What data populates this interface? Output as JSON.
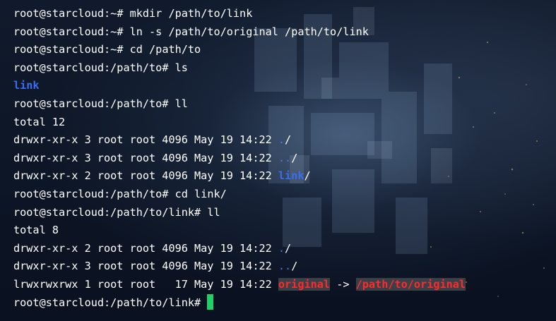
{
  "prompt": "root@starcloud:",
  "session": [
    {
      "cwd": "~",
      "command": "mkdir /path/to/link"
    },
    {
      "cwd": "~",
      "command": "ln -s /path/to/original /path/to/link"
    },
    {
      "cwd": "~",
      "command": "cd /path/to"
    },
    {
      "cwd": "/path/to",
      "command": "ls"
    },
    {
      "cwd": "/path/to",
      "command": "ll"
    },
    {
      "cwd": "/path/to",
      "command": "cd link/"
    },
    {
      "cwd": "/path/to/link",
      "command": "ll"
    },
    {
      "cwd": "/path/to/link",
      "command": ""
    }
  ],
  "ls_output": [
    "link"
  ],
  "ll_output_1": {
    "total": "total 12",
    "entries": [
      {
        "meta": "drwxr-xr-x 3 root root 4096 May 19 14:22 ",
        "name": ".",
        "suffix": "/"
      },
      {
        "meta": "drwxr-xr-x 3 root root 4096 May 19 14:22 ",
        "name": "..",
        "suffix": "/"
      },
      {
        "meta": "drwxr-xr-x 2 root root 4096 May 19 14:22 ",
        "name": "link",
        "suffix": "/"
      }
    ]
  },
  "ll_output_2": {
    "total": "total 8",
    "entries": [
      {
        "meta": "drwxr-xr-x 2 root root 4096 May 19 14:22 ",
        "name": ".",
        "suffix": "/"
      },
      {
        "meta": "drwxr-xr-x 3 root root 4096 May 19 14:22 ",
        "name": "..",
        "suffix": "/"
      },
      {
        "meta": "lrwxrwxrwx 1 root root   17 May 19 14:22 ",
        "name": "original",
        "arrow": " -> ",
        "target": "/path/to/original"
      }
    ]
  },
  "colors": {
    "directory": "#3b6df0",
    "broken_link": "#ff2a2a",
    "cursor": "#1fd06a"
  }
}
